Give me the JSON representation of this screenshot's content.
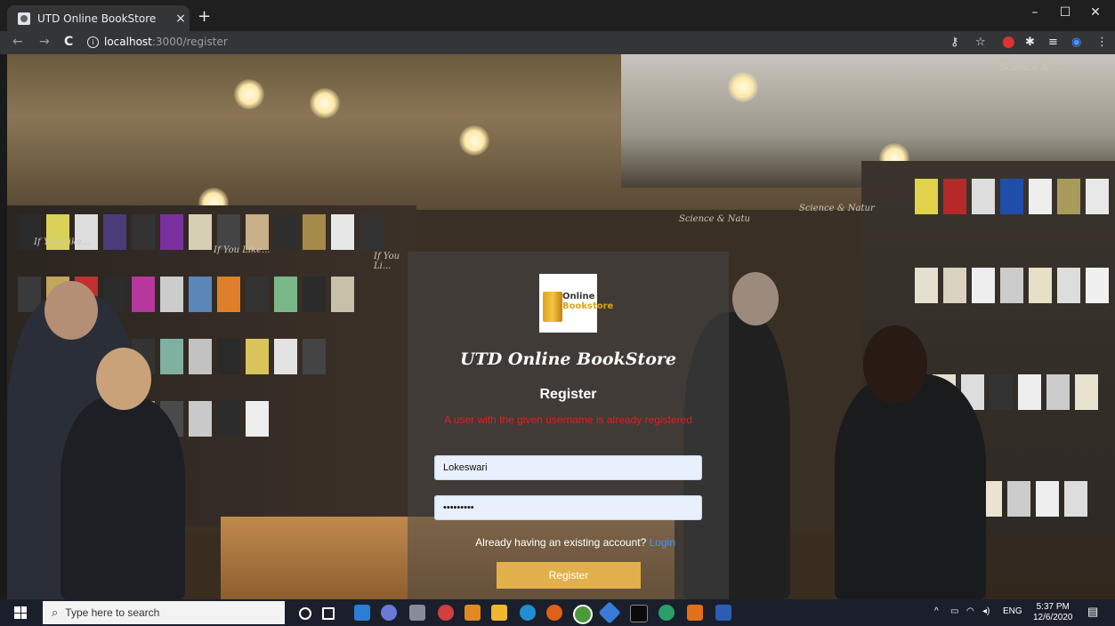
{
  "browser": {
    "tab_title": "UTD Online BookStore",
    "tab_close": "×",
    "new_tab": "+",
    "url_host": "localhost",
    "url_path": ":3000/register",
    "nav": {
      "back": "←",
      "forward": "→",
      "reload": "C"
    },
    "window_controls": {
      "minimize": "–",
      "maximize": "☐",
      "close": "✕"
    }
  },
  "scene_signs": [
    "If You Like...",
    "If You Like...",
    "If You Li...",
    "Science & Natur",
    "Science & Natu",
    "Science & ..."
  ],
  "register": {
    "logo_text_line1": "Online",
    "logo_text_line2": "Bookstore",
    "brand": "UTD Online BookStore",
    "heading": "Register",
    "error": "A user with the given username is already registered",
    "username_value": "Lokeswari",
    "password_value": "•••••••••",
    "login_prompt": "Already having an existing account?",
    "login_link": "Login",
    "register_button": "Register"
  },
  "taskbar": {
    "search_placeholder": "Type here to search",
    "language": "ENG",
    "time": "5:37 PM",
    "date": "12/6/2020"
  },
  "colors": {
    "accent_button": "#e2b04a",
    "error_text": "#e02020",
    "link": "#4a8fff"
  }
}
